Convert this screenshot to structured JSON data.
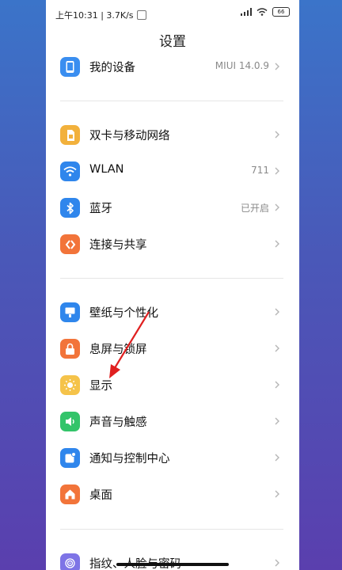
{
  "status_bar": {
    "time_speed": "上午10:31 | 3.7K/s",
    "battery": "66"
  },
  "header": {
    "title": "设置"
  },
  "colors": {
    "device": "#3a8ef0",
    "dual_sim": "#f2b13c",
    "wlan": "#2f86ec",
    "bluetooth": "#2f86ec",
    "connection": "#f2743a",
    "wallpaper": "#2f86ec",
    "lockscreen": "#f2743a",
    "display": "#f5c34a",
    "sound": "#33c46a",
    "notification": "#2f86ec",
    "home_screen": "#f2743a",
    "fingerprint": "#7e74e6",
    "annotation_arrow": "#e02020"
  },
  "sections": [
    {
      "items": [
        {
          "label": "我的设备",
          "value": "MIUI 14.0.9",
          "icon": "phone-icon"
        }
      ]
    },
    {
      "items": [
        {
          "label": "双卡与移动网络",
          "value": "",
          "icon": "sim-card-icon"
        },
        {
          "label": "WLAN",
          "value": "711",
          "icon": "wifi-icon"
        },
        {
          "label": "蓝牙",
          "value": "已开启",
          "icon": "bluetooth-icon"
        },
        {
          "label": "连接与共享",
          "value": "",
          "icon": "share-icon"
        }
      ]
    },
    {
      "items": [
        {
          "label": "壁纸与个性化",
          "value": "",
          "icon": "wallpaper-icon"
        },
        {
          "label": "息屏与锁屏",
          "value": "",
          "icon": "lock-icon"
        },
        {
          "label": "显示",
          "value": "",
          "icon": "sun-icon"
        },
        {
          "label": "声音与触感",
          "value": "",
          "icon": "speaker-icon"
        },
        {
          "label": "通知与控制中心",
          "value": "",
          "icon": "notification-icon"
        },
        {
          "label": "桌面",
          "value": "",
          "icon": "home-icon"
        }
      ]
    },
    {
      "items": [
        {
          "label": "指纹、人脸与密码",
          "value": "",
          "icon": "fingerprint-icon"
        }
      ]
    }
  ]
}
